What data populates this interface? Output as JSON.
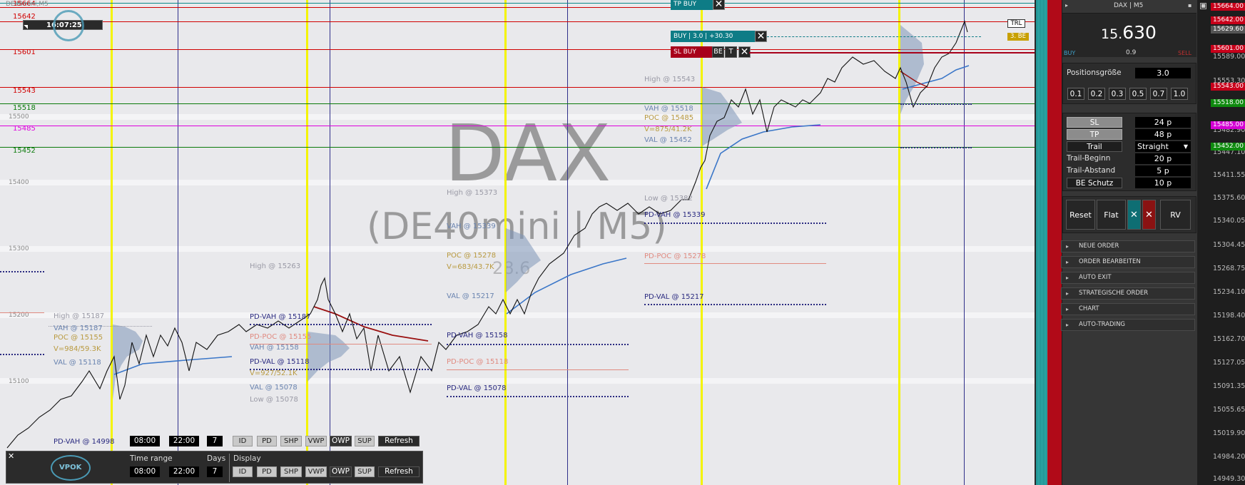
{
  "window": {
    "clock": "16:07:25",
    "symbol_tiny": "DE40mini,M5"
  },
  "watermark": {
    "line1": "DAX",
    "line2": "(DE40mini | M5)",
    "faint": "28.6"
  },
  "price_levels": [
    {
      "label": "15664",
      "color": "#d00000"
    },
    {
      "label": "15642",
      "color": "#d00000"
    },
    {
      "label": "15601",
      "color": "#d00000"
    },
    {
      "label": "15543",
      "color": "#d00000"
    },
    {
      "label": "15518",
      "color": "#0a7a0a"
    },
    {
      "label": "15500",
      "color": "#8a8a8a"
    },
    {
      "label": "15485",
      "color": "#dd00dd"
    },
    {
      "label": "15452",
      "color": "#0a7a0a"
    },
    {
      "label": "15400",
      "color": "#8a8a8a"
    },
    {
      "label": "15300",
      "color": "#8a8a8a"
    },
    {
      "label": "15200",
      "color": "#8a8a8a"
    },
    {
      "label": "15100",
      "color": "#8a8a8a"
    }
  ],
  "profiles": {
    "day1": {
      "high": "High @ 15187",
      "vah": "VAH @ 15187",
      "poc": "POC @ 15155",
      "vol": "V=984/59.3K",
      "val": "VAL @ 15118",
      "pdvah": "PD-VAH @ 14998"
    },
    "day2": {
      "high": "High @ 15263",
      "pdvah": "PD-VAH @ 15187",
      "pdpoc": "PD-POC @ 15155",
      "vah": "VAH @ 15158",
      "pdval": "PD-VAL @ 15118",
      "vol": "V=927/52.1K",
      "val": "VAL @ 15078",
      "low": "Low @ 15078"
    },
    "day3": {
      "high": "High @ 15373",
      "vah": "VAH @ 15339",
      "poc": "POC @ 15278",
      "vol": "V=683/43.7K",
      "val": "VAL @ 15217",
      "pdvah": "PD-VAH @ 15158",
      "pdpoc": "PD-POC @ 15118",
      "pdval": "PD-VAL @ 15078"
    },
    "day4": {
      "high": "High @ 15543",
      "vah": "VAH @ 15518",
      "poc": "POC @ 15485",
      "vol": "V=875/41.2K",
      "val": "VAL @ 15452",
      "low": "Low @ 15382",
      "pdvah": "PD-VAH @ 15339",
      "pdpoc": "PD-POC @ 15278",
      "pdval": "PD-VAL @ 15217"
    }
  },
  "orders": {
    "tp": "TP BUY",
    "buy": "BUY | 3.0 | +30.30",
    "sl": "SL BUY",
    "be": "BE",
    "t": "T",
    "trl": "TRL",
    "be_tag": "3. BE"
  },
  "vpok": {
    "logo": "VPOK",
    "time_range_label": "Time range",
    "days_label": "Days",
    "display_label": "Display",
    "start": "08:00",
    "end": "22:00",
    "days": "7",
    "buttons": [
      "ID",
      "PD",
      "SHP",
      "VWP",
      "OWP",
      "SUP"
    ],
    "refresh": "Refresh"
  },
  "panel": {
    "title": "DAX | M5",
    "price": "15.630",
    "price_prefix": "15.",
    "price_main": "630",
    "buy_label": "BUY",
    "spread": "0.9",
    "sell_label": "SELL",
    "position_size_label": "Positionsgröße",
    "position_size": "3.0",
    "quick_sizes": [
      "0.1",
      "0.2",
      "0.3",
      "0.5",
      "0.7",
      "1.0"
    ],
    "sl_label": "SL",
    "sl_value": "24 p",
    "tp_label": "TP",
    "tp_value": "48 p",
    "trail_label": "Trail",
    "trail_value": "Straight",
    "trail_start_label": "Trail-Beginn",
    "trail_start": "20 p",
    "trail_dist_label": "Trail-Abstand",
    "trail_dist": "5 p",
    "be_label": "BE Schutz",
    "be_value": "10 p",
    "reset": "Reset",
    "flat": "Flat",
    "rv": "RV",
    "sections": [
      "NEUE ORDER",
      "ORDER BEARBEITEN",
      "AUTO EXIT",
      "STRATEGISCHE ORDER",
      "CHART",
      "AUTO-TRADING"
    ]
  },
  "axis": {
    "ticks": [
      "15589.00",
      "15553.30",
      "15518.00",
      "15482.90",
      "15447.10",
      "15411.55",
      "15375.60",
      "15340.05",
      "15304.45",
      "15268.75",
      "15234.10",
      "15198.40",
      "15162.70",
      "15127.05",
      "15091.35",
      "15055.65",
      "15019.90",
      "14984.20",
      "14949.30"
    ],
    "tags": [
      {
        "text": "15664.00",
        "color": "#c8001a"
      },
      {
        "text": "15642.00",
        "color": "#c8001a"
      },
      {
        "text": "15629.60",
        "color": "#555555"
      },
      {
        "text": "15601.00",
        "color": "#c8001a"
      },
      {
        "text": "15543.00",
        "color": "#c8001a"
      },
      {
        "text": "15518.00",
        "color": "#0f8a0f"
      },
      {
        "text": "15485.00",
        "color": "#d400d4"
      },
      {
        "text": "15452.00",
        "color": "#0f8a0f"
      }
    ]
  }
}
